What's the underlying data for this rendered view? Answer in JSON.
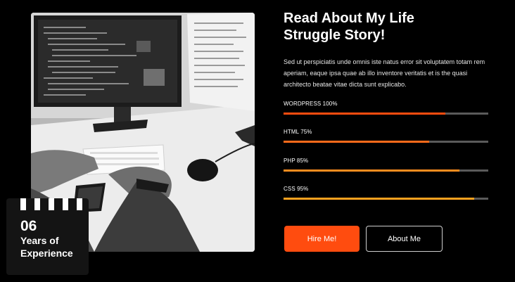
{
  "about": {
    "title_line1": "Read About My Life",
    "title_line2": "Struggle Story!",
    "description": "Sed ut perspiciatis unde omnis iste natus error sit voluptatem  totam rem aperiam, eaque ipsa quae ab illo inventore veritatis et is the quasi architecto beatae vitae dicta sunt explicabo."
  },
  "experience": {
    "number": "06",
    "label": "Years of Experience"
  },
  "skills": [
    {
      "label": "WORDPRESS 100%",
      "level": 0.79,
      "color": "#ff4c0f"
    },
    {
      "label": "HTML 75%",
      "level": 0.71,
      "color": "#ff6a1a"
    },
    {
      "label": "PHP 85%",
      "level": 0.86,
      "color": "#ff8d1f"
    },
    {
      "label": "CSS 95%",
      "level": 0.93,
      "color": "#ffa21f"
    }
  ],
  "buttons": {
    "hire": "Hire Me!",
    "about": "About Me"
  },
  "photo": {
    "icon": "developer-workstation-photo"
  },
  "colors": {
    "accent": "#ff4c0f",
    "background": "#000000",
    "track": "#5a5a5a"
  }
}
